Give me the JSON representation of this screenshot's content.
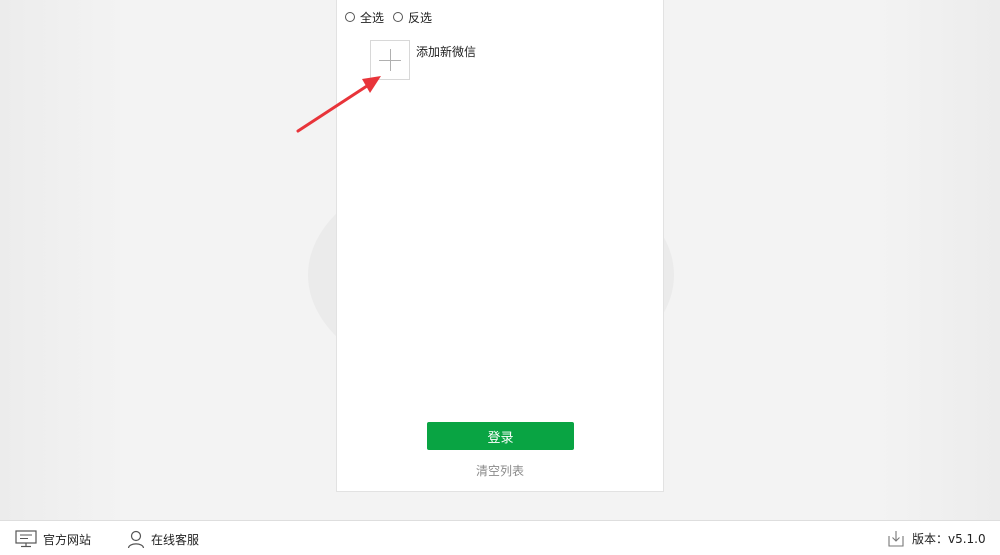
{
  "selection": {
    "select_all_label": "全选",
    "invert_label": "反选"
  },
  "account_list": {
    "add_label": "添加新微信"
  },
  "actions": {
    "login_label": "登录",
    "clear_label": "清空列表"
  },
  "footer": {
    "website_label": "官方网站",
    "service_label": "在线客服",
    "version_label": "版本：v5.1.0"
  },
  "colors": {
    "accent": "#09a443",
    "annotation_arrow": "#e8343a"
  },
  "icons": {
    "website": "monitor-icon",
    "service": "person-icon",
    "version": "download-icon",
    "add": "plus-icon"
  }
}
